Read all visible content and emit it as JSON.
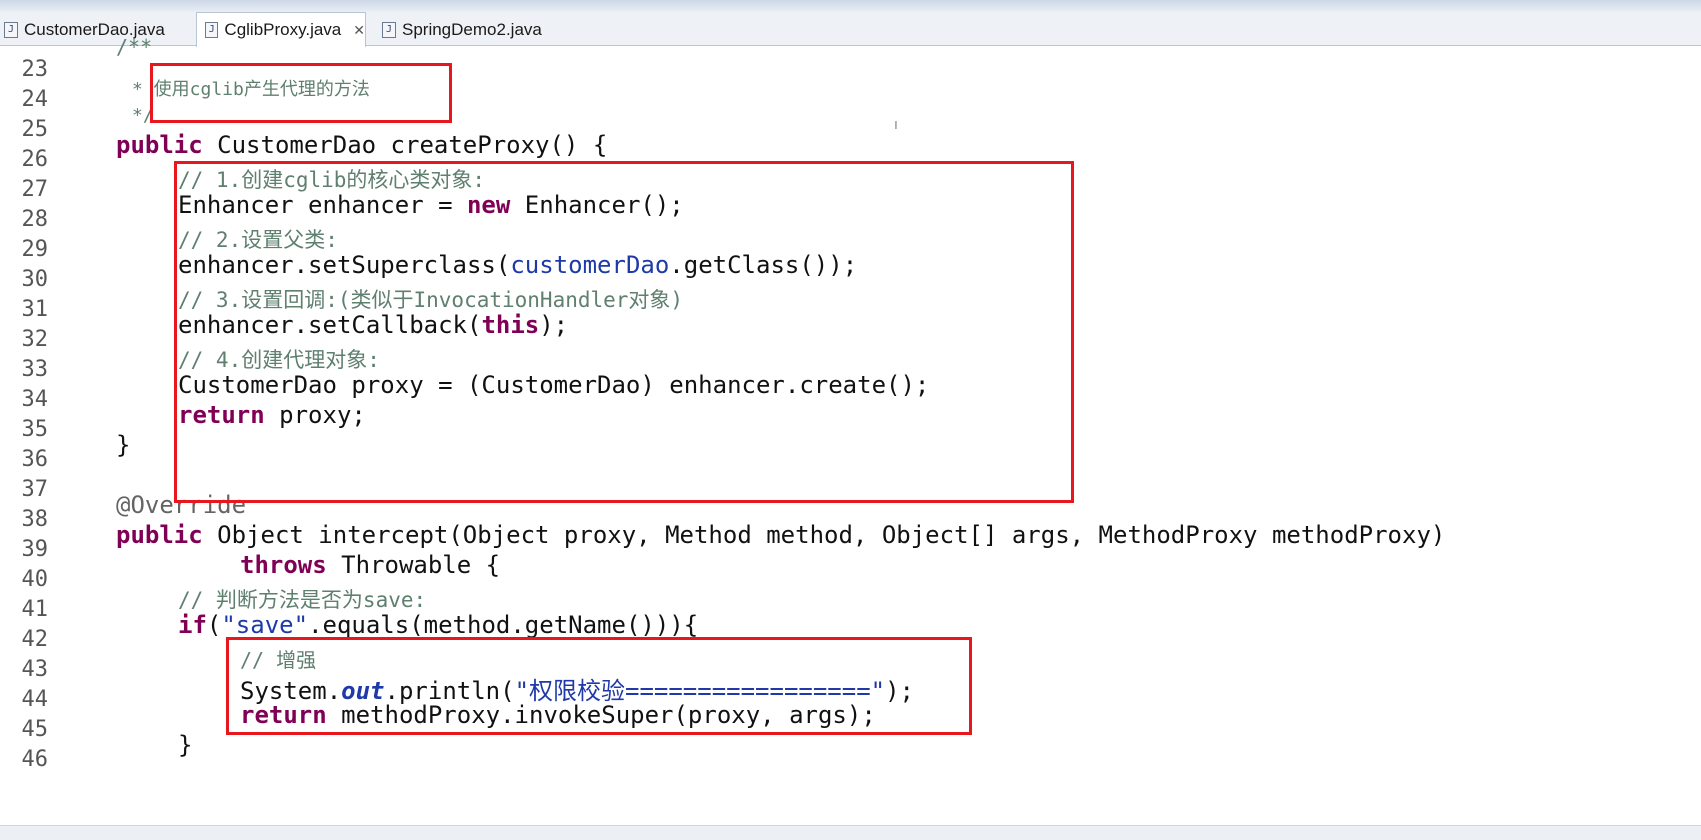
{
  "tabs": [
    {
      "label": "CustomerDao.java",
      "icon": "java-file-icon",
      "active": false
    },
    {
      "label": "CglibProxy.java",
      "icon": "java-file-icon",
      "active": true
    },
    {
      "label": "SpringDemo2.java",
      "icon": "java-file-icon",
      "active": false
    }
  ],
  "line_numbers": [
    "23",
    "24",
    "25",
    "26",
    "27",
    "28",
    "29",
    "30",
    "31",
    "32",
    "33",
    "34",
    "35",
    "36",
    "37",
    "38",
    "39",
    "40",
    "41",
    "42",
    "43",
    "44",
    "45",
    "46"
  ],
  "code": {
    "l22": "/**",
    "l23": "* 使用cglib产生代理的方法",
    "l24": "*/",
    "l25_kw": "public",
    "l25_rest": " CustomerDao createProxy() {",
    "l26": "// 1.创建cglib的核心类对象:",
    "l27_a": "Enhancer enhancer = ",
    "l27_kw": "new",
    "l27_b": " Enhancer();",
    "l28": "// 2.设置父类:",
    "l29_a": "enhancer.setSuperclass(",
    "l29_f": "customerDao",
    "l29_b": ".getClass());",
    "l30": "// 3.设置回调:(类似于InvocationHandler对象)",
    "l31_a": "enhancer.setCallback(",
    "l31_kw": "this",
    "l31_b": ");",
    "l32": "// 4.创建代理对象:",
    "l33": "CustomerDao proxy = (CustomerDao) enhancer.create();",
    "l34_kw": "return",
    "l34_rest": " proxy;",
    "l35": "}",
    "l37": "@Override",
    "l38_kw": "public",
    "l38_rest": " Object intercept(Object proxy, Method method, Object[] args, MethodProxy methodProxy)",
    "l39_kw": "throws",
    "l39_rest": " Throwable {",
    "l40": "// 判断方法是否为save:",
    "l41_kw": "if",
    "l41_a": "(",
    "l41_str": "\"save\"",
    "l41_b": ".equals(method.getName())){",
    "l42": "// 增强",
    "l43_a": "System.",
    "l43_f": "out",
    "l43_b": ".println(",
    "l43_str": "\"权限校验=================\"",
    "l43_c": ");",
    "l44_kw": "return",
    "l44_rest": " methodProxy.invokeSuper(proxy, args);",
    "l45": "}"
  },
  "colors": {
    "highlight_box": "#e8161d",
    "keyword": "#7f0055",
    "comment": "#5f7f6f",
    "field": "#1f3aa8"
  }
}
